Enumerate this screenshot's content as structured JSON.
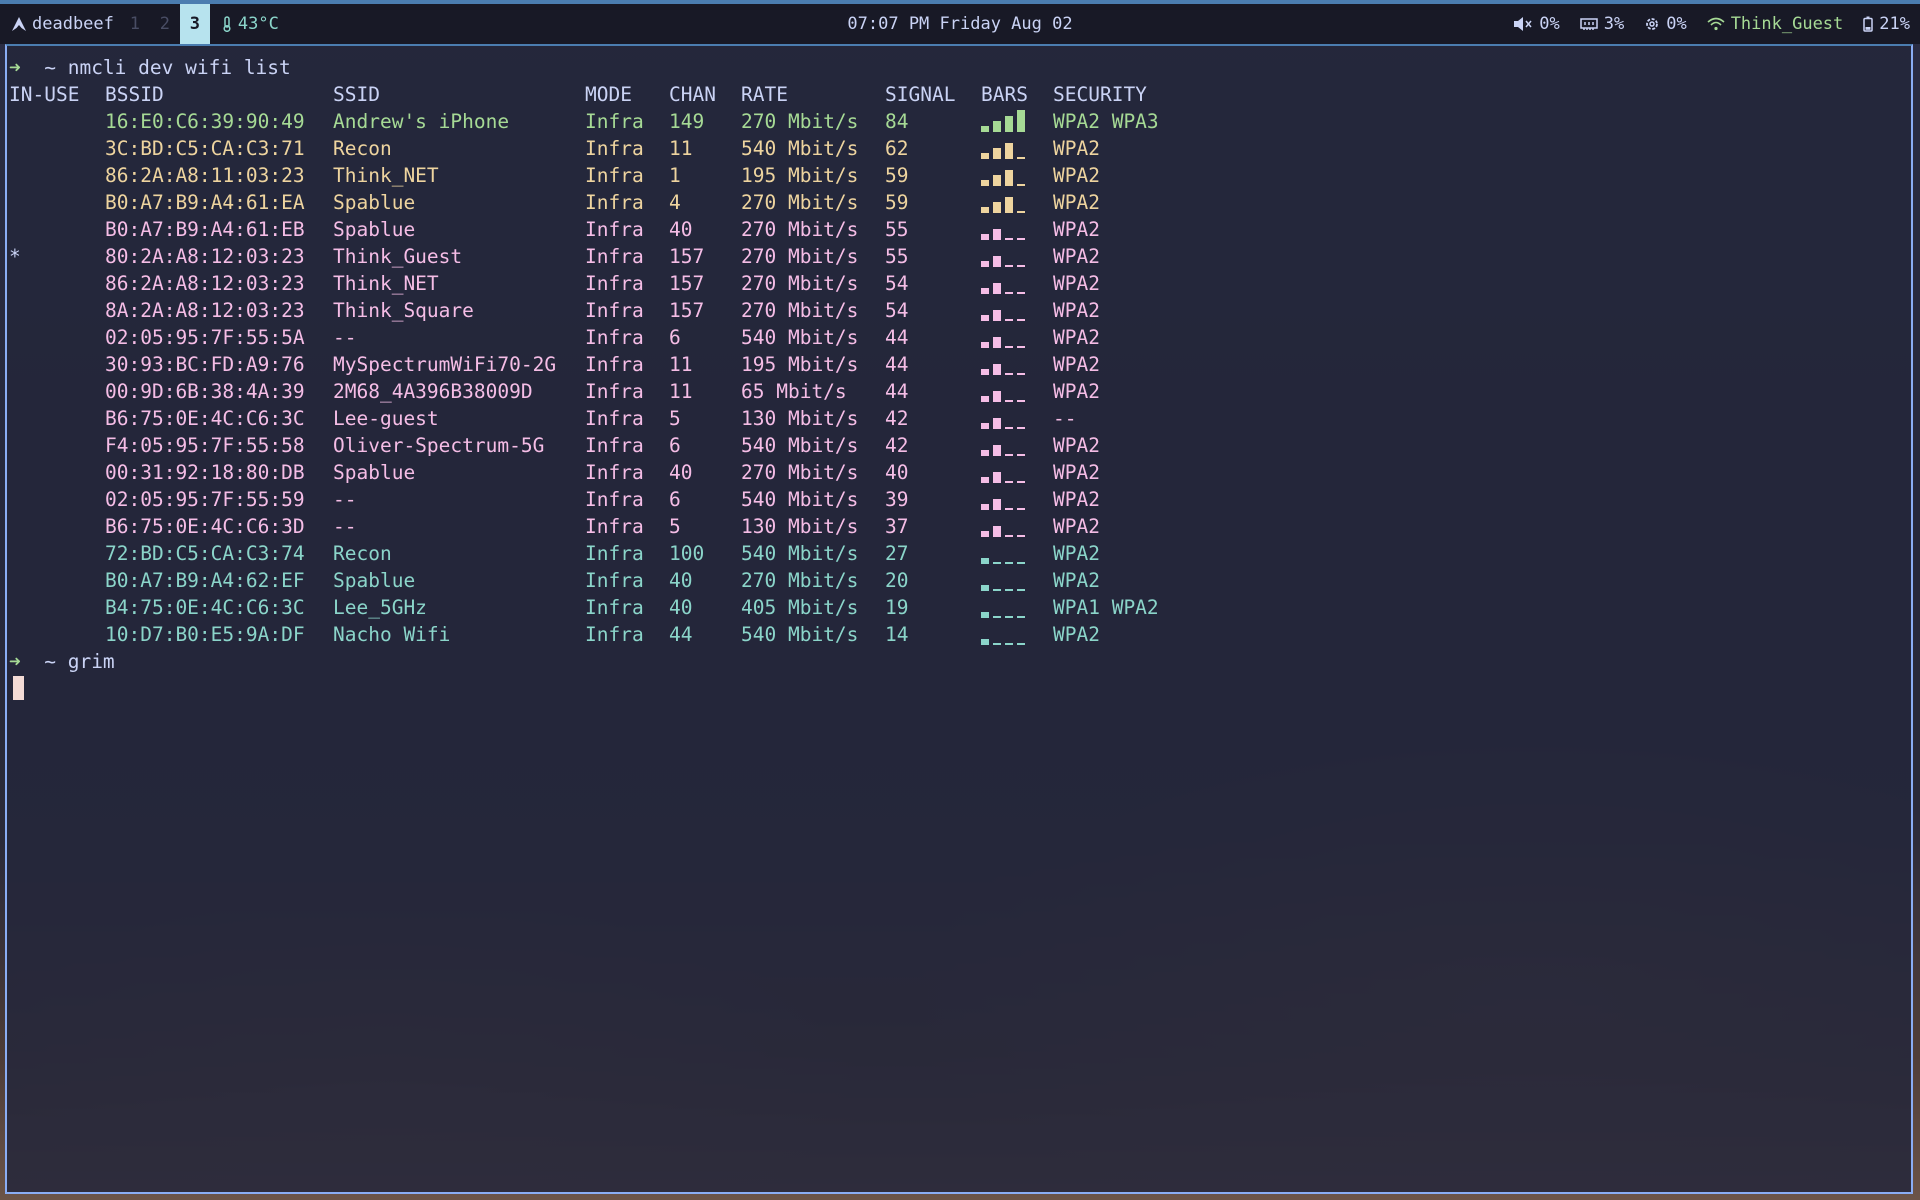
{
  "topbar": {
    "logo_icon": "arch-linux-icon",
    "hostname": "deadbeef",
    "workspaces": [
      "1",
      "2",
      "3"
    ],
    "active_workspace": "3",
    "temperature": "43°C",
    "clock": "07:07 PM  Friday Aug 02",
    "volume": "0%",
    "memory": "3%",
    "cpu": "0%",
    "wifi_ssid": "Think_Guest",
    "battery": "21%"
  },
  "terminal": {
    "command1": "~ nmcli dev wifi list",
    "command2": "~ grim",
    "headers": {
      "in_use": "IN-USE",
      "bssid": "BSSID",
      "ssid": "SSID",
      "mode": "MODE",
      "chan": "CHAN",
      "rate": "RATE",
      "signal": "SIGNAL",
      "bars": "BARS",
      "security": "SECURITY"
    },
    "rows": [
      {
        "in_use": "",
        "bssid": "16:E0:C6:39:90:49",
        "ssid": "Andrew's iPhone",
        "mode": "Infra",
        "chan": "149",
        "rate": "270 Mbit/s",
        "signal": "84",
        "bars": 4,
        "security": "WPA2 WPA3"
      },
      {
        "in_use": "",
        "bssid": "3C:BD:C5:CA:C3:71",
        "ssid": "Recon",
        "mode": "Infra",
        "chan": "11",
        "rate": "540 Mbit/s",
        "signal": "62",
        "bars": 3,
        "security": "WPA2"
      },
      {
        "in_use": "",
        "bssid": "86:2A:A8:11:03:23",
        "ssid": "Think_NET",
        "mode": "Infra",
        "chan": "1",
        "rate": "195 Mbit/s",
        "signal": "59",
        "bars": 3,
        "security": "WPA2"
      },
      {
        "in_use": "",
        "bssid": "B0:A7:B9:A4:61:EA",
        "ssid": "Spablue",
        "mode": "Infra",
        "chan": "4",
        "rate": "270 Mbit/s",
        "signal": "59",
        "bars": 3,
        "security": "WPA2"
      },
      {
        "in_use": "",
        "bssid": "B0:A7:B9:A4:61:EB",
        "ssid": "Spablue",
        "mode": "Infra",
        "chan": "40",
        "rate": "270 Mbit/s",
        "signal": "55",
        "bars": 2,
        "security": "WPA2"
      },
      {
        "in_use": "*",
        "bssid": "80:2A:A8:12:03:23",
        "ssid": "Think_Guest",
        "mode": "Infra",
        "chan": "157",
        "rate": "270 Mbit/s",
        "signal": "55",
        "bars": 2,
        "security": "WPA2"
      },
      {
        "in_use": "",
        "bssid": "86:2A:A8:12:03:23",
        "ssid": "Think_NET",
        "mode": "Infra",
        "chan": "157",
        "rate": "270 Mbit/s",
        "signal": "54",
        "bars": 2,
        "security": "WPA2"
      },
      {
        "in_use": "",
        "bssid": "8A:2A:A8:12:03:23",
        "ssid": "Think_Square",
        "mode": "Infra",
        "chan": "157",
        "rate": "270 Mbit/s",
        "signal": "54",
        "bars": 2,
        "security": "WPA2"
      },
      {
        "in_use": "",
        "bssid": "02:05:95:7F:55:5A",
        "ssid": "--",
        "mode": "Infra",
        "chan": "6",
        "rate": "540 Mbit/s",
        "signal": "44",
        "bars": 2,
        "security": "WPA2"
      },
      {
        "in_use": "",
        "bssid": "30:93:BC:FD:A9:76",
        "ssid": "MySpectrumWiFi70-2G",
        "mode": "Infra",
        "chan": "11",
        "rate": "195 Mbit/s",
        "signal": "44",
        "bars": 2,
        "security": "WPA2"
      },
      {
        "in_use": "",
        "bssid": "00:9D:6B:38:4A:39",
        "ssid": "2M68_4A396B38009D",
        "mode": "Infra",
        "chan": "11",
        "rate": "65 Mbit/s",
        "signal": "44",
        "bars": 2,
        "security": "WPA2"
      },
      {
        "in_use": "",
        "bssid": "B6:75:0E:4C:C6:3C",
        "ssid": "Lee-guest",
        "mode": "Infra",
        "chan": "5",
        "rate": "130 Mbit/s",
        "signal": "42",
        "bars": 2,
        "security": "--"
      },
      {
        "in_use": "",
        "bssid": "F4:05:95:7F:55:58",
        "ssid": "Oliver-Spectrum-5G",
        "mode": "Infra",
        "chan": "6",
        "rate": "540 Mbit/s",
        "signal": "42",
        "bars": 2,
        "security": "WPA2"
      },
      {
        "in_use": "",
        "bssid": "00:31:92:18:80:DB",
        "ssid": "Spablue",
        "mode": "Infra",
        "chan": "40",
        "rate": "270 Mbit/s",
        "signal": "40",
        "bars": 2,
        "security": "WPA2"
      },
      {
        "in_use": "",
        "bssid": "02:05:95:7F:55:59",
        "ssid": "--",
        "mode": "Infra",
        "chan": "6",
        "rate": "540 Mbit/s",
        "signal": "39",
        "bars": 2,
        "security": "WPA2"
      },
      {
        "in_use": "",
        "bssid": "B6:75:0E:4C:C6:3D",
        "ssid": "--",
        "mode": "Infra",
        "chan": "5",
        "rate": "130 Mbit/s",
        "signal": "37",
        "bars": 2,
        "security": "WPA2"
      },
      {
        "in_use": "",
        "bssid": "72:BD:C5:CA:C3:74",
        "ssid": "Recon",
        "mode": "Infra",
        "chan": "100",
        "rate": "540 Mbit/s",
        "signal": "27",
        "bars": 1,
        "security": "WPA2"
      },
      {
        "in_use": "",
        "bssid": "B0:A7:B9:A4:62:EF",
        "ssid": "Spablue",
        "mode": "Infra",
        "chan": "40",
        "rate": "270 Mbit/s",
        "signal": "20",
        "bars": 1,
        "security": "WPA2"
      },
      {
        "in_use": "",
        "bssid": "B4:75:0E:4C:C6:3C",
        "ssid": "Lee_5GHz",
        "mode": "Infra",
        "chan": "40",
        "rate": "405 Mbit/s",
        "signal": "19",
        "bars": 1,
        "security": "WPA1 WPA2"
      },
      {
        "in_use": "",
        "bssid": "10:D7:B0:E5:9A:DF",
        "ssid": "Nacho Wifi",
        "mode": "Infra",
        "chan": "44",
        "rate": "540 Mbit/s",
        "signal": "14",
        "bars": 1,
        "security": "WPA2"
      }
    ]
  },
  "colors": {
    "strong": "#a6da95",
    "good": "#eed49f",
    "fair": "#f5bde6",
    "weak": "#8bd5ca",
    "prompt": "#a6da95",
    "text": "#cad3f5"
  }
}
